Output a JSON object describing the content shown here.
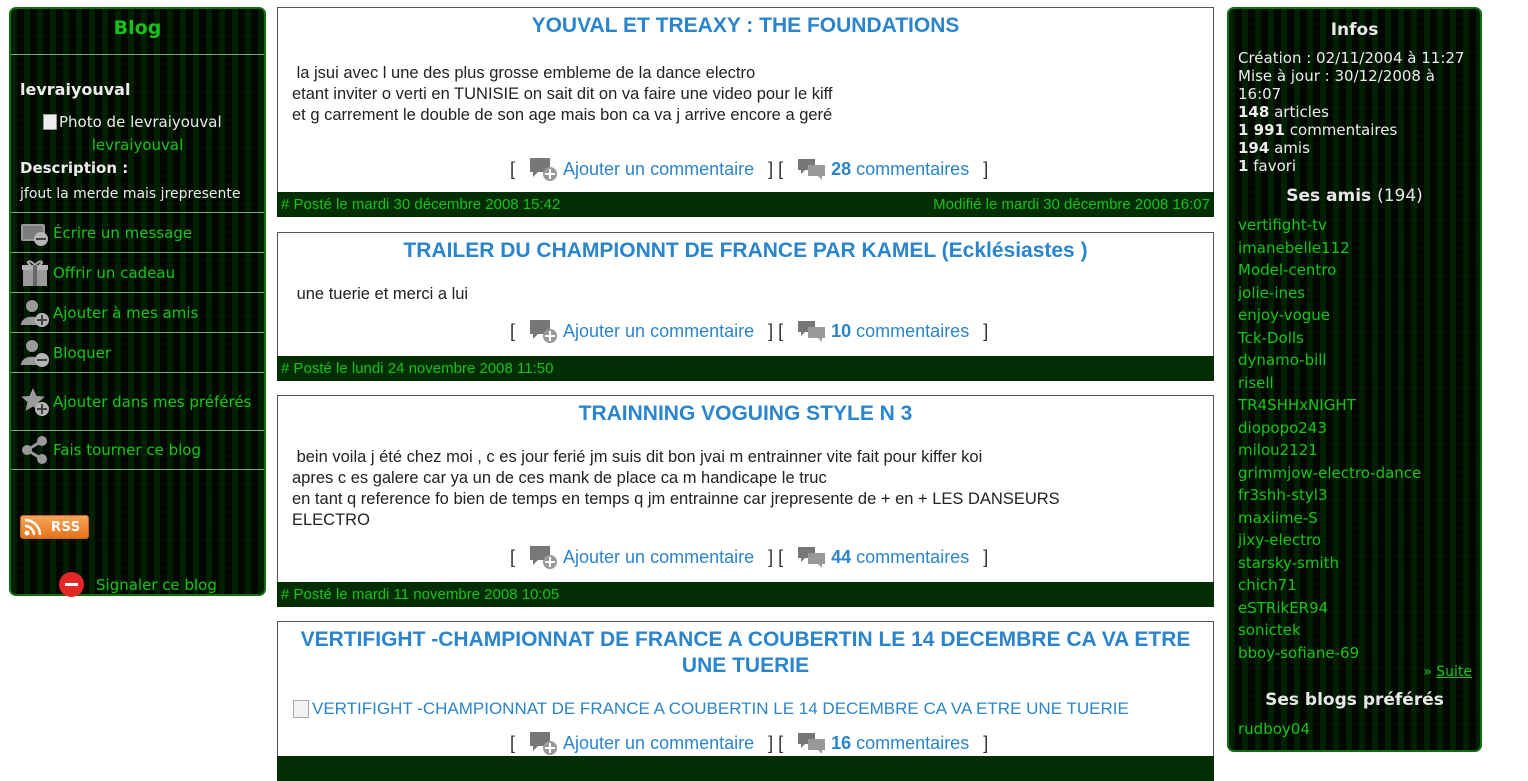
{
  "left": {
    "title": "Blog",
    "username": "levraiyouval",
    "photo_alt": "Photo de levraiyouval",
    "photo_name": "levraiyouval",
    "description_label": "Description :",
    "description_text": "jfout la merde mais jrepresente",
    "actions": [
      {
        "label": "Écrire un message",
        "icon": "message-icon"
      },
      {
        "label": "Offrir un cadeau",
        "icon": "gift-icon"
      },
      {
        "label": "Ajouter à mes amis",
        "icon": "add-friend-icon"
      },
      {
        "label": "Bloquer",
        "icon": "block-user-icon"
      },
      {
        "label": "Ajouter dans mes préférés",
        "icon": "add-favorite-icon"
      },
      {
        "label": "Fais tourner ce blog",
        "icon": "share-icon"
      }
    ],
    "rss_label": "RSS",
    "report_label": "Signaler ce blog"
  },
  "posts": [
    {
      "title": "YOUVAL ET TREAXY : THE FOUNDATIONS",
      "body": [
        " la jsui avec l une des plus grosse embleme de la dance electro",
        "etant inviter o verti en TUNISIE on sait dit on va faire une video pour le kiff",
        "et g carrement le double de son age mais bon ca va j arrive encore a geré"
      ],
      "add_comment": "Ajouter un commentaire",
      "comment_count": "28",
      "comments_label": "commentaires",
      "posted": "# Posté le mardi 30 décembre 2008 15:42",
      "modified": "Modifié le mardi 30 décembre 2008 16:07"
    },
    {
      "title": "TRAILER DU CHAMPIONNT DE FRANCE PAR KAMEL (Ecklésiastes )",
      "body": [
        " une tuerie et merci a lui"
      ],
      "add_comment": "Ajouter un commentaire",
      "comment_count": "10",
      "comments_label": "commentaires",
      "posted": "# Posté le lundi 24 novembre 2008 11:50",
      "modified": ""
    },
    {
      "title": "TRAINNING VOGUING STYLE N 3",
      "body": [
        " bein voila j été chez moi , c es jour ferié jm suis dit bon jvai m entrainner vite fait pour kiffer koi",
        "apres c es galere car ya un de ces mank de place ca m handicape le truc",
        "en tant q reference fo bien de temps en temps q jm entrainne car jrepresente de + en + LES DANSEURS ELECTRO"
      ],
      "add_comment": "Ajouter un commentaire",
      "comment_count": "44",
      "comments_label": "commentaires",
      "posted": "# Posté le mardi 11 novembre 2008 10:05",
      "modified": ""
    },
    {
      "title": "VERTIFIGHT -CHAMPIONNAT DE FRANCE A COUBERTIN LE 14 DECEMBRE CA VA ETRE UNE TUERIE",
      "image_alt": "VERTIFIGHT -CHAMPIONNAT DE FRANCE A COUBERTIN LE 14 DECEMBRE CA VA ETRE UNE TUERIE",
      "add_comment": "Ajouter un commentaire",
      "comment_count": "16",
      "comments_label": "commentaires"
    }
  ],
  "right": {
    "infos_title": "Infos",
    "creation": "Création : 02/11/2004 à 11:27",
    "update": "Mise à jour : 30/12/2008 à 16:07",
    "articles_count": "148",
    "articles_label": "articles",
    "comments_count": "1 991",
    "comments_label": "commentaires",
    "friends_count": "194",
    "friends_label": "amis",
    "favorites_count": "1",
    "favorites_label": "favori",
    "friends_title": "Ses amis",
    "friends_title_count": "(194)",
    "friends": [
      "vertifight-tv",
      "imanebelle112",
      "Model-centro",
      "jolie-ines",
      "enjoy-vogue",
      "Tck-Dolls",
      "dynamo-bill",
      "risell",
      "TR4SHHxNIGHT",
      "diopopo243",
      "milou2121",
      "grimmjow-electro-dance",
      "fr3shh-styl3",
      "maxiime-S",
      "jixy-electro",
      "starsky-smith",
      "chich71",
      "eSTRikER94",
      "sonictek",
      "bboy-sofiane-69"
    ],
    "suite_prefix": "»",
    "suite_label": "Suite",
    "fav_blogs_title": "Ses blogs préférés",
    "fav_blogs": [
      "rudboy04"
    ]
  },
  "colors": {
    "accent_green": "#19c419",
    "link_blue": "#2b85cc",
    "footer_bg": "#032d03"
  }
}
